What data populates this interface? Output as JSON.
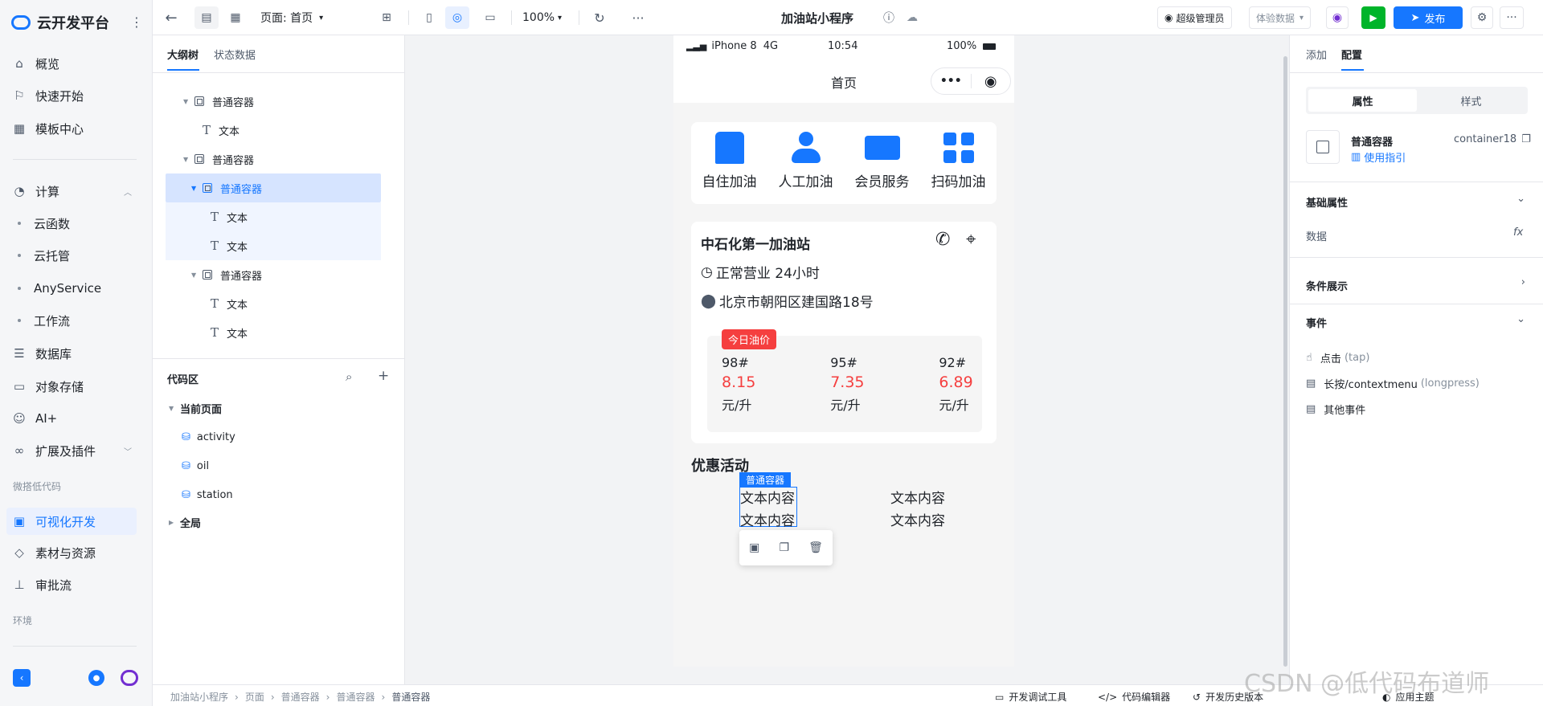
{
  "app": {
    "name": "云开发平台",
    "page_title": "加油站小程序"
  },
  "nav": {
    "items": [
      {
        "label": "概览",
        "icon": "home-icon"
      },
      {
        "label": "快速开始",
        "icon": "flag-icon"
      },
      {
        "label": "模板中心",
        "icon": "template-icon"
      }
    ],
    "compute": {
      "label": "计算",
      "children": [
        "云函数",
        "云托管",
        "AnyService",
        "工作流"
      ]
    },
    "more": [
      "数据库",
      "对象存储",
      "AI+"
    ],
    "extensions": "扩展及插件",
    "section_lowcode": "微搭低代码",
    "lowcode_items": [
      "可视化开发",
      "素材与资源",
      "审批流"
    ],
    "section_env": "环境"
  },
  "toolbar": {
    "page_label": "页面: 首页",
    "zoom": "100%",
    "admin": "超级管理员",
    "env": "体验数据",
    "publish": "发布"
  },
  "outline": {
    "tab_tree": "大纲树",
    "tab_state": "状态数据",
    "nodes": [
      "普通容器",
      "文本",
      "普通容器",
      "普通容器",
      "文本",
      "文本",
      "普通容器",
      "文本",
      "文本"
    ],
    "code_area": "代码区",
    "current_page": "当前页面",
    "queries": [
      "activity",
      "oil",
      "station"
    ],
    "global": "全局"
  },
  "phone": {
    "status": {
      "carrier": "iPhone 8",
      "net": "4G",
      "time": "10:54",
      "battery": "100%"
    },
    "title": "首页",
    "services": [
      "自住加油",
      "人工加油",
      "会员服务",
      "扫码加油"
    ],
    "station": {
      "name": "中石化第一加油站",
      "hours": "正常营业 24小时",
      "address": "北京市朝阳区建国路18号",
      "badge": "今日油价",
      "prices": [
        {
          "grade": "98#",
          "price": "8.15",
          "unit": "元/升"
        },
        {
          "grade": "95#",
          "price": "7.35",
          "unit": "元/升"
        },
        {
          "grade": "92#",
          "price": "6.89",
          "unit": "元/升"
        }
      ]
    },
    "promo_title": "优惠活动",
    "selected_label": "普通容器",
    "texts": [
      "文本内容",
      "文本内容",
      "文本内容",
      "文本内容"
    ]
  },
  "right": {
    "tab_add": "添加",
    "tab_config": "配置",
    "seg_props": "属性",
    "seg_style": "样式",
    "comp_name": "普通容器",
    "comp_id": "container18",
    "guide": "使用指引",
    "basic": "基础属性",
    "data_label": "数据",
    "cond": "条件展示",
    "events": "事件",
    "event_tap": "点击",
    "event_tap_hint": "(tap)",
    "event_long": "长按/contextmenu",
    "event_long_hint": "(longpress)",
    "event_other": "其他事件"
  },
  "bottom": {
    "breadcrumb": [
      "加油站小程序",
      "页面",
      "普通容器",
      "普通容器",
      "普通容器"
    ],
    "debug": "开发调试工具",
    "code_editor": "代码编辑器",
    "history": "开发历史版本",
    "theme": "应用主题"
  },
  "watermark": "CSDN @低代码布道师",
  "colors": {
    "accent": "#1677ff",
    "price": "#f53f3f",
    "green": "#00b42a"
  }
}
